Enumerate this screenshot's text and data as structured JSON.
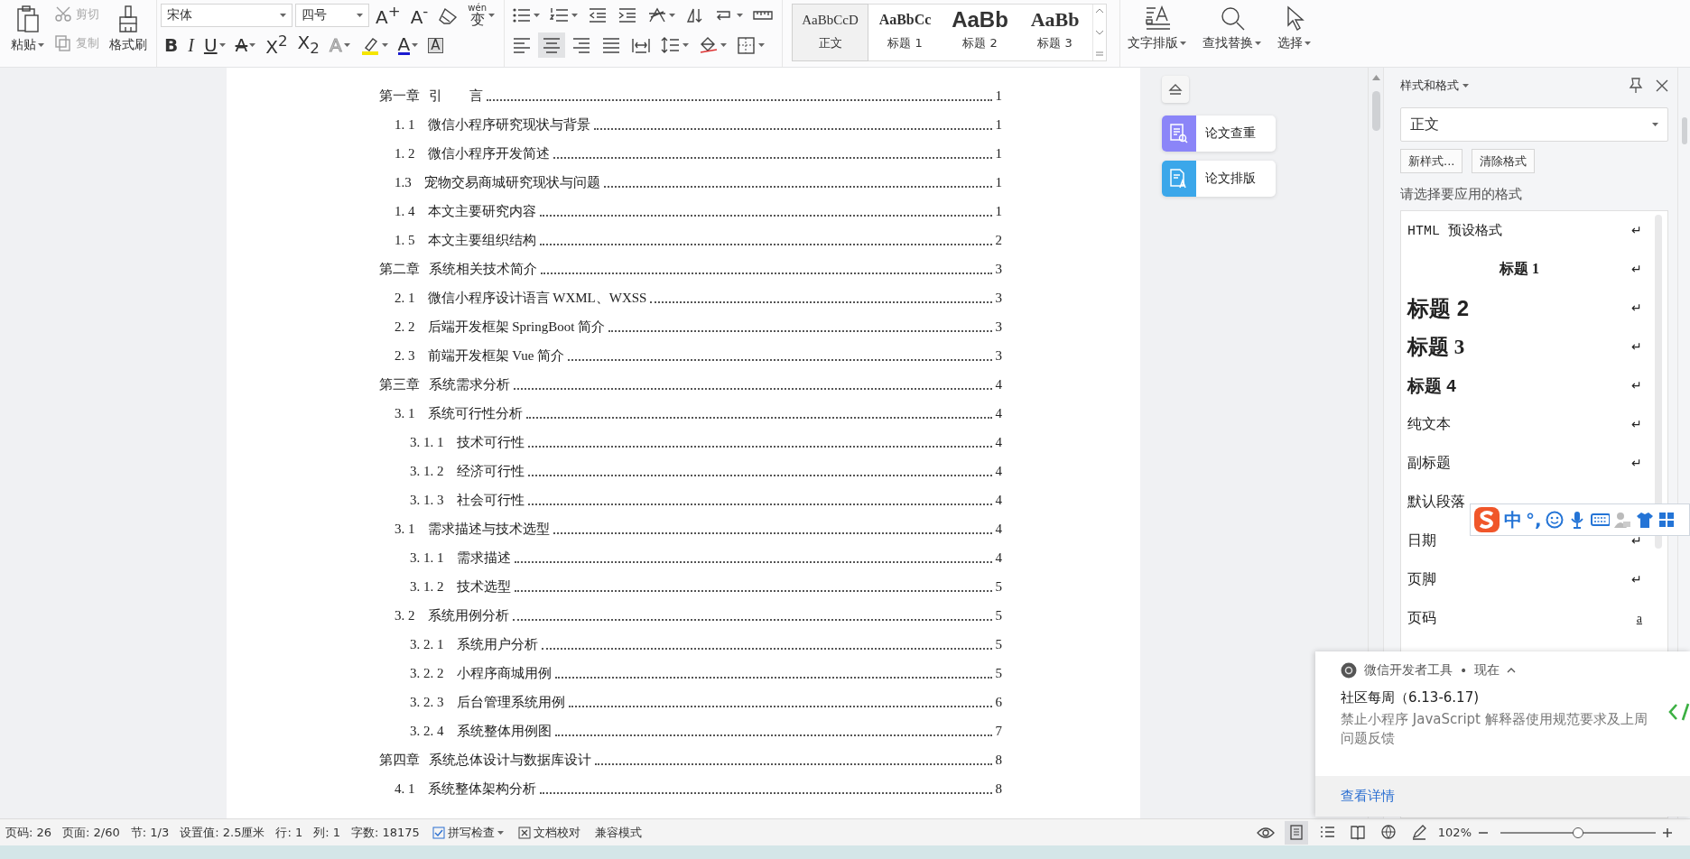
{
  "ribbon": {
    "clipboard": {
      "paste": "粘贴",
      "cut": {
        "label": "剪切",
        "disabled": true
      },
      "copy": {
        "label": "复制",
        "disabled": true
      },
      "format_painter": "格式刷"
    },
    "font": {
      "font_name": "宋体",
      "font_size": "四号",
      "grow": "A$^{+}$",
      "shrink": "A$^{-}$",
      "phonetic_ruby": "wén",
      "phonetic_base": "变",
      "bold": "B",
      "italic": "I",
      "underline": "U",
      "strikethrough": "A",
      "superscript": "X$^{2}$",
      "subscript": "X$_{2}$",
      "text_effect": "A",
      "font_color": "A",
      "char_shading": "A"
    },
    "paragraph": {
      "align": [
        {
          "selected": false
        },
        {
          "selected": true
        },
        {
          "selected": false
        },
        {
          "selected": false
        },
        {
          "selected": false
        }
      ]
    },
    "styles_gallery": [
      {
        "preview": "AaBbCcD",
        "label": "正文",
        "selected": true
      },
      {
        "preview": "AaBbCc",
        "label": "标题 1",
        "selected": false
      },
      {
        "preview": "AaBb",
        "label": "标题 2",
        "selected": false
      },
      {
        "preview": "AaBb",
        "label": "标题 3",
        "selected": false
      }
    ],
    "tools": [
      "文字排版",
      "查找替换",
      "选择"
    ]
  },
  "toc": [
    {
      "number": "第一章",
      "title": "引　　言",
      "page": "1",
      "children": [
        {
          "number": "1. 1",
          "title": "微信小程序研究现状与背景",
          "page": "1"
        },
        {
          "number": "1. 2",
          "title": "微信小程序开发简述",
          "page": "1"
        },
        {
          "number": "1.3",
          "title": "宠物交易商城研究现状与问题",
          "page": "1"
        },
        {
          "number": "1. 4",
          "title": "本文主要研究内容",
          "page": "1"
        },
        {
          "number": "1. 5",
          "title": "本文主要组织结构",
          "page": "2"
        }
      ]
    },
    {
      "number": "第二章",
      "title": "系统相关技术简介",
      "page": "3",
      "children": [
        {
          "number": "2. 1",
          "title": "微信小程序设计语言 WXML、WXSS",
          "page": "3"
        },
        {
          "number": "2. 2",
          "title": "后端开发框架 SpringBoot 简介",
          "page": "3"
        },
        {
          "number": "2. 3",
          "title": "前端开发框架 Vue 简介",
          "page": "3"
        }
      ]
    },
    {
      "number": "第三章",
      "title": "系统需求分析",
      "page": "4",
      "children": [
        {
          "number": "3. 1",
          "title": "系统可行性分析",
          "page": "4",
          "children": [
            {
              "number": "3. 1. 1",
              "title": "技术可行性",
              "page": "4"
            },
            {
              "number": "3. 1. 2",
              "title": "经济可行性",
              "page": "4"
            },
            {
              "number": "3. 1. 3",
              "title": "社会可行性",
              "page": "4"
            }
          ]
        },
        {
          "number": "3. 1",
          "title": "需求描述与技术选型",
          "page": "4",
          "children": [
            {
              "number": "3. 1. 1",
              "title": "需求描述",
              "page": "4"
            },
            {
              "number": "3. 1. 2",
              "title": "技术选型",
              "page": "5"
            }
          ]
        },
        {
          "number": "3. 2",
          "title": "系统用例分析",
          "page": "5",
          "children": [
            {
              "number": "3. 2. 1",
              "title": "系统用户分析",
              "page": "5"
            },
            {
              "number": "3. 2. 2",
              "title": "小程序商城用例",
              "page": "5"
            },
            {
              "number": "3. 2. 3",
              "title": "后台管理系统用例",
              "page": "6"
            },
            {
              "number": "3. 2. 4",
              "title": "系统整体用例图",
              "page": "7"
            }
          ]
        }
      ]
    },
    {
      "number": "第四章",
      "title": "系统总体设计与数据库设计",
      "page": "8",
      "children": [
        {
          "number": "4. 1",
          "title": "系统整体架构分析",
          "page": "8"
        }
      ]
    }
  ],
  "side_tools": [
    {
      "label": "论文查重",
      "color": "#8b85f8"
    },
    {
      "label": "论文排版",
      "color": "#3ba7ea"
    }
  ],
  "styles_panel": {
    "title": "样式和格式",
    "current_style": "正文",
    "buttons": [
      "新样式...",
      "清除格式"
    ],
    "prompt": "请选择要应用的格式",
    "styles": [
      {
        "name": "HTML 预设格式",
        "kind": "html",
        "mark": "↵"
      },
      {
        "name": "标题 1",
        "kind": "heading1",
        "mark": "↵"
      },
      {
        "name": "标题 2",
        "kind": "heading2",
        "mark": "↵"
      },
      {
        "name": "标题 3",
        "kind": "heading3",
        "mark": "↵"
      },
      {
        "name": "标题 4",
        "kind": "heading4",
        "mark": "↵"
      },
      {
        "name": "纯文本",
        "kind": "plain",
        "mark": "↵"
      },
      {
        "name": "副标题",
        "kind": "plain",
        "mark": "↵"
      },
      {
        "name": "默认段落",
        "kind": "plain"
      },
      {
        "name": "日期",
        "kind": "plain",
        "mark": "↵"
      },
      {
        "name": "页脚",
        "kind": "plain",
        "mark": "↵"
      },
      {
        "name": "页码",
        "kind": "character",
        "mark": "a"
      }
    ]
  },
  "ime_toolbar": {
    "mode": "中",
    "punctuation": "°,"
  },
  "notification": {
    "app": "微信开发者工具",
    "separator": "•",
    "time": "现在",
    "title": "社区每周（6.13-6.17)",
    "body": "禁止小程序 JavaScript 解释器使用规范要求及上周问题反馈",
    "action": "查看详情"
  },
  "status_bar": {
    "items": [
      "页码: 26",
      "页面: 2/60",
      "节: 1/3",
      "设置值: 2.5厘米",
      "行: 1",
      "列: 1",
      "字数: 18175"
    ],
    "spell_check": "拼写检查",
    "proofread": "文档校对",
    "compat_mode": "兼容模式",
    "views": [
      {
        "selected": true
      },
      {
        "selected": false
      },
      {
        "selected": false
      },
      {
        "selected": false
      },
      {
        "selected": false
      }
    ],
    "zoom": "102%",
    "zoom_slider": {
      "level": 0.5
    }
  }
}
